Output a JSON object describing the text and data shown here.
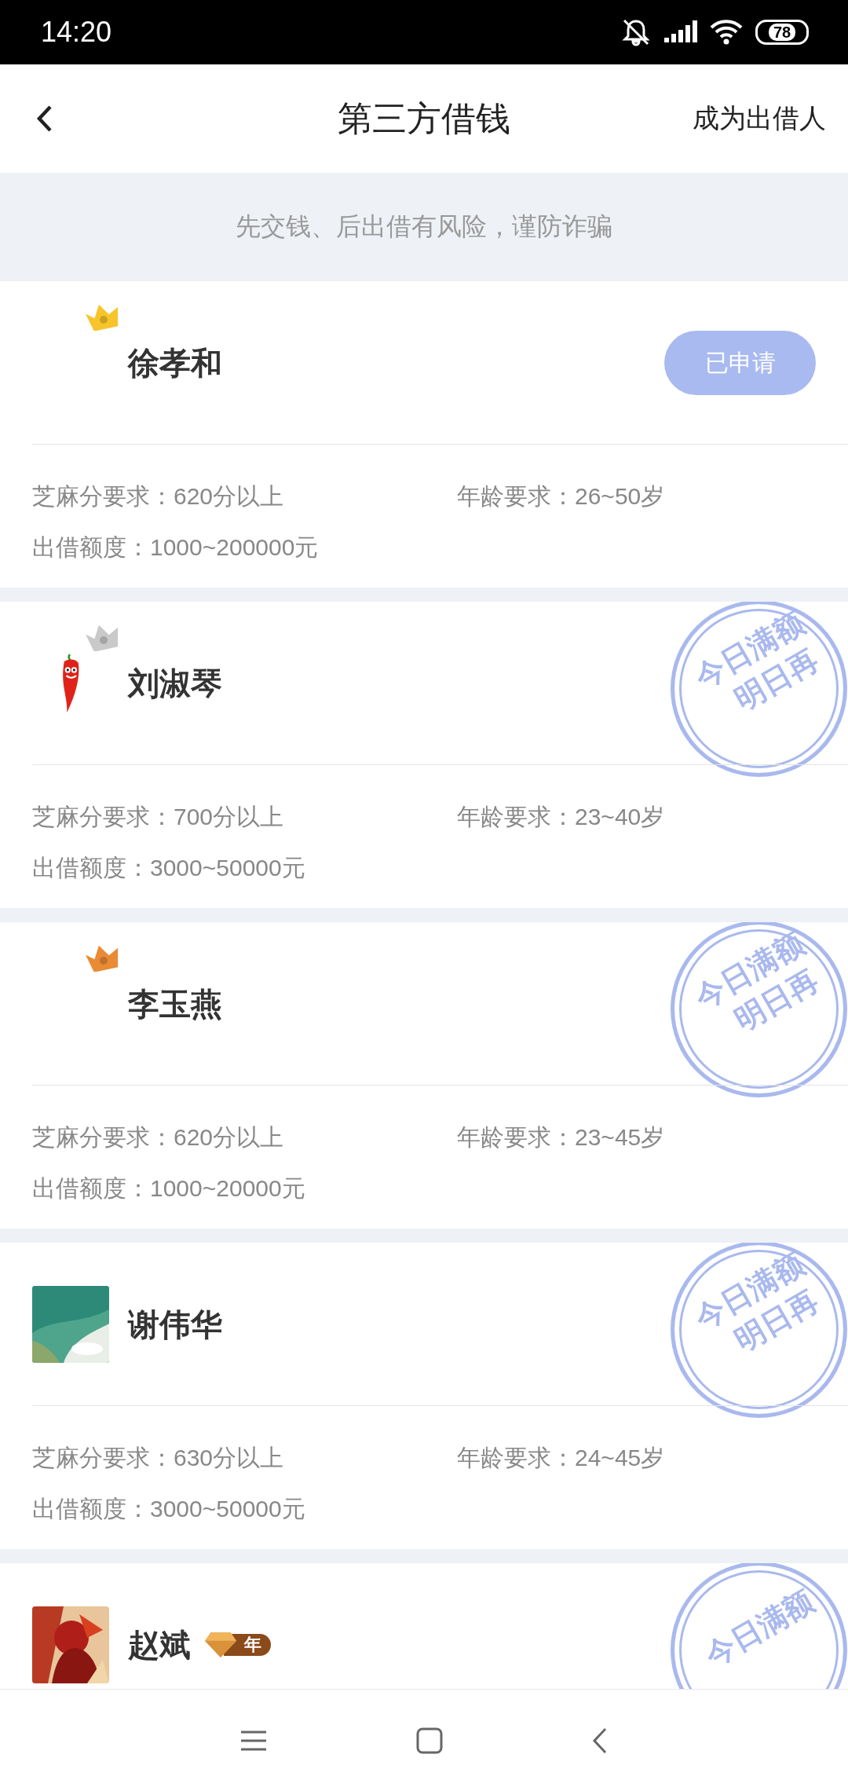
{
  "status_bar": {
    "time": "14:20",
    "battery": "78"
  },
  "header": {
    "title": "第三方借钱",
    "action": "成为出借人"
  },
  "notice": "先交钱、后出借有风险，谨防诈骗",
  "lenders": [
    {
      "name": "徐孝和",
      "badge": {
        "kind": "crown",
        "color": "#f7c52b"
      },
      "status": {
        "kind": "button",
        "label": "已申请"
      },
      "details": [
        "芝麻分要求：620分以上",
        "年龄要求：26~50岁",
        "出借额度：1000~200000元"
      ]
    },
    {
      "name": "刘淑琴",
      "avatar": {
        "kind": "chili"
      },
      "badge": {
        "kind": "crown",
        "color": "#c9c9c9"
      },
      "status": {
        "kind": "stamp",
        "lines": [
          "今日满额",
          "明日再"
        ]
      },
      "details": [
        "芝麻分要求：700分以上",
        "年龄要求：23~40岁",
        "出借额度：3000~50000元"
      ]
    },
    {
      "name": "李玉燕",
      "badge": {
        "kind": "crown",
        "color": "#e98a35"
      },
      "status": {
        "kind": "stamp",
        "lines": [
          "今日满额",
          "明日再"
        ]
      },
      "details": [
        "芝麻分要求：620分以上",
        "年龄要求：23~45岁",
        "出借额度：1000~20000元"
      ]
    },
    {
      "name": "谢伟华",
      "status": {
        "kind": "stamp",
        "lines": [
          "今日满额",
          "明日再"
        ]
      },
      "details": [
        "芝麻分要求：630分以上",
        "年龄要求：24~45岁",
        "出借额度：3000~50000元"
      ]
    },
    {
      "name": "赵斌",
      "badge": {
        "kind": "vip",
        "label": "年"
      },
      "status": {
        "kind": "stamp",
        "lines": [
          "今日满额"
        ]
      }
    }
  ]
}
